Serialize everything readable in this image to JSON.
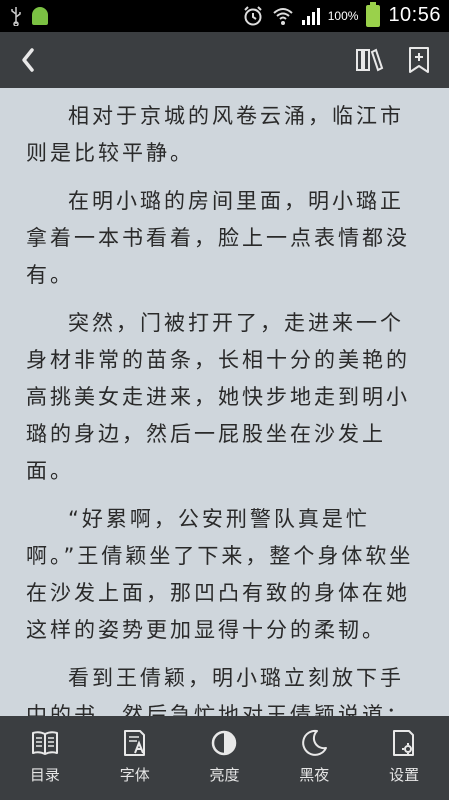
{
  "status_bar": {
    "battery_percent": "100%",
    "time": "10:56"
  },
  "content": {
    "paragraphs": [
      "相对于京城的风卷云涌，临江市则是比较平静。",
      "在明小璐的房间里面，明小璐正拿着一本书看着，脸上一点表情都没有。",
      "突然，门被打开了，走进来一个身材非常的苗条，长相十分的美艳的高挑美女走进来，她快步地走到明小璐的身边，然后一屁股坐在沙发上面。",
      "“好累啊，公安刑警队真是忙啊。”王倩颖坐了下来，整个身体软坐在沙发上面，那凹凸有致的身体在她这样的姿势更加显得十分的柔韧。",
      "看到王倩颖，明小璐立刻放下手中的书，然后急忙地对王倩颖说道："
    ]
  },
  "toolbar": {
    "items": [
      {
        "label": "目录",
        "icon": "book-icon"
      },
      {
        "label": "字体",
        "icon": "font-icon"
      },
      {
        "label": "亮度",
        "icon": "brightness-icon"
      },
      {
        "label": "黑夜",
        "icon": "moon-icon"
      },
      {
        "label": "设置",
        "icon": "settings-icon"
      }
    ]
  },
  "colors": {
    "page_background": "#cfd6dc",
    "bar_background": "#3b3e41",
    "text": "#2a2a2a"
  }
}
